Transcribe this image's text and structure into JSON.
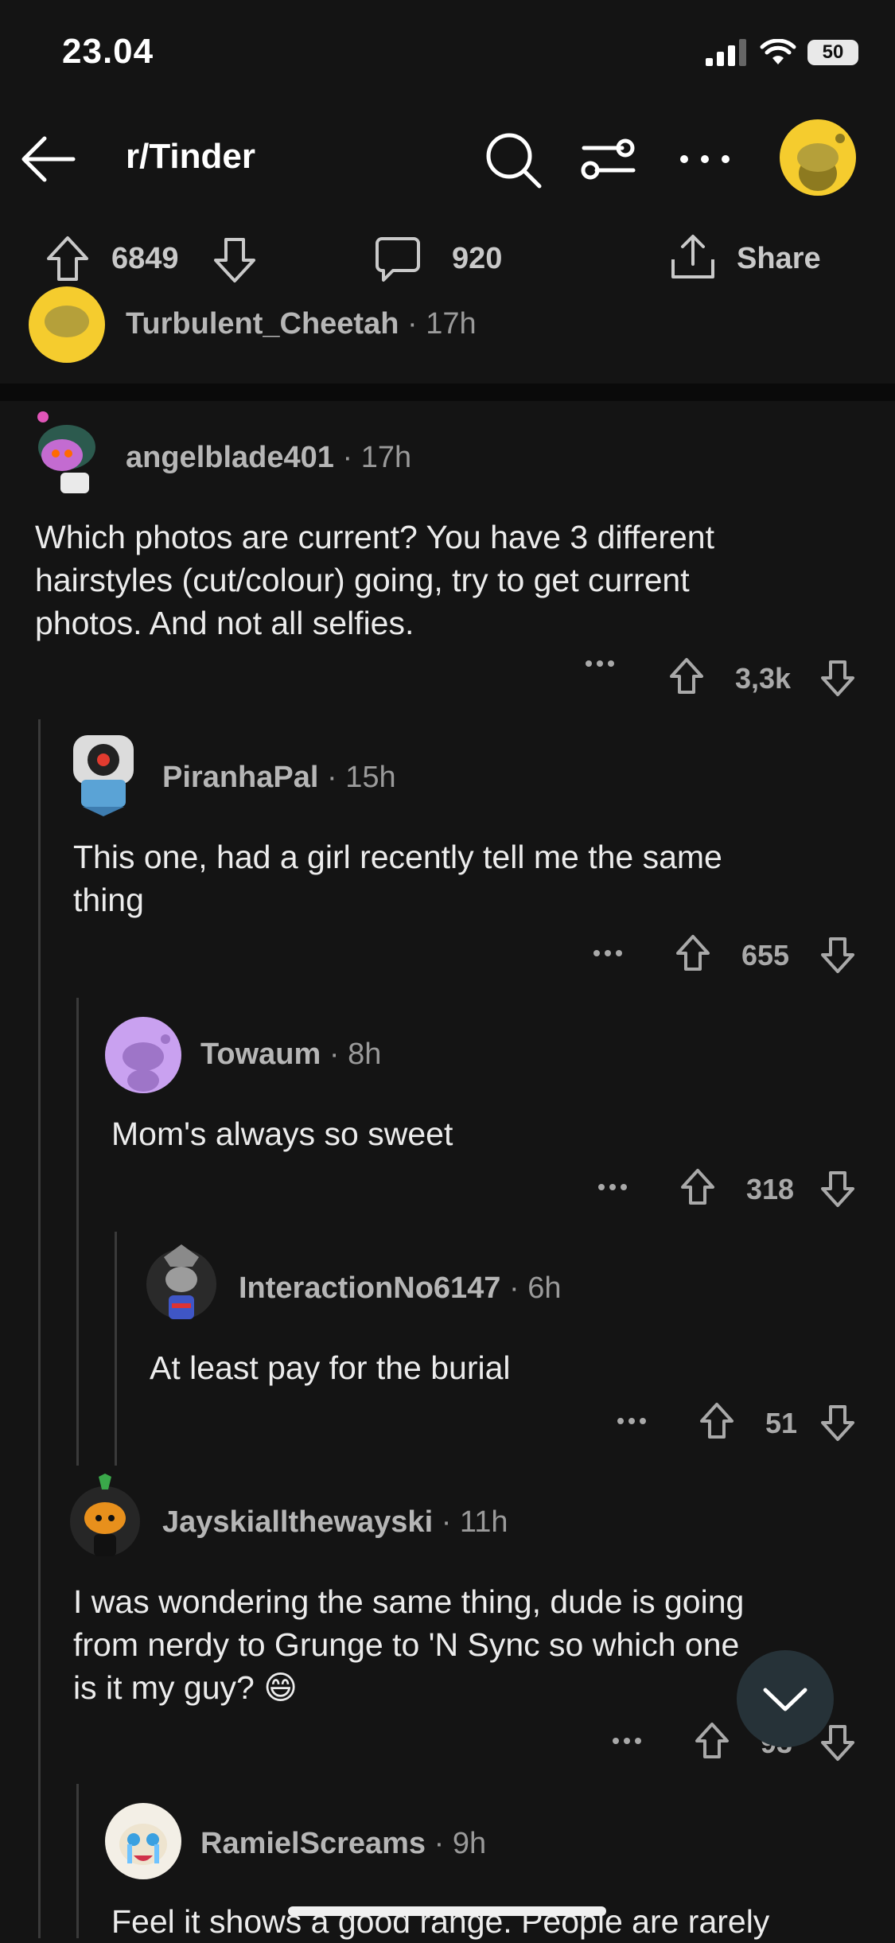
{
  "status": {
    "time": "23.04",
    "battery": "50"
  },
  "header": {
    "subreddit": "r/Tinder"
  },
  "actions": {
    "upvotes": "6849",
    "comments": "920",
    "share": "Share"
  },
  "top_comment_stub": {
    "user": "Turbulent_Cheetah",
    "age": "17h"
  },
  "comments": [
    {
      "user": "angelblade401",
      "age": "17h",
      "lines": [
        "Which photos are current? You have 3 different",
        "hairstyles (cut/colour) going, try to get current",
        "photos. And not all selfies."
      ],
      "score": "3,3k"
    },
    {
      "user": "PiranhaPal",
      "age": "15h",
      "lines": [
        "This one, had a girl recently tell me the same",
        "thing"
      ],
      "score": "655"
    },
    {
      "user": "Towaum",
      "age": "8h",
      "lines": [
        "Mom's always so sweet"
      ],
      "score": "318"
    },
    {
      "user": "InteractionNo6147",
      "age": "6h",
      "lines": [
        "At least pay for the burial"
      ],
      "score": "51"
    },
    {
      "user": "Jayskiallthewayski",
      "age": "11h",
      "lines": [
        "I was wondering the same thing, dude is going",
        "from nerdy to Grunge to 'N Sync so which one",
        "is it my guy? 😄"
      ],
      "score": "93"
    },
    {
      "user": "RamielScreams",
      "age": "9h",
      "lines": [
        "Feel it shows a good range. People are rarely"
      ]
    }
  ],
  "colors": {
    "bg": "#141414",
    "divider": "#0a0a0a",
    "snoo_yellow": "#f5cc2e"
  }
}
